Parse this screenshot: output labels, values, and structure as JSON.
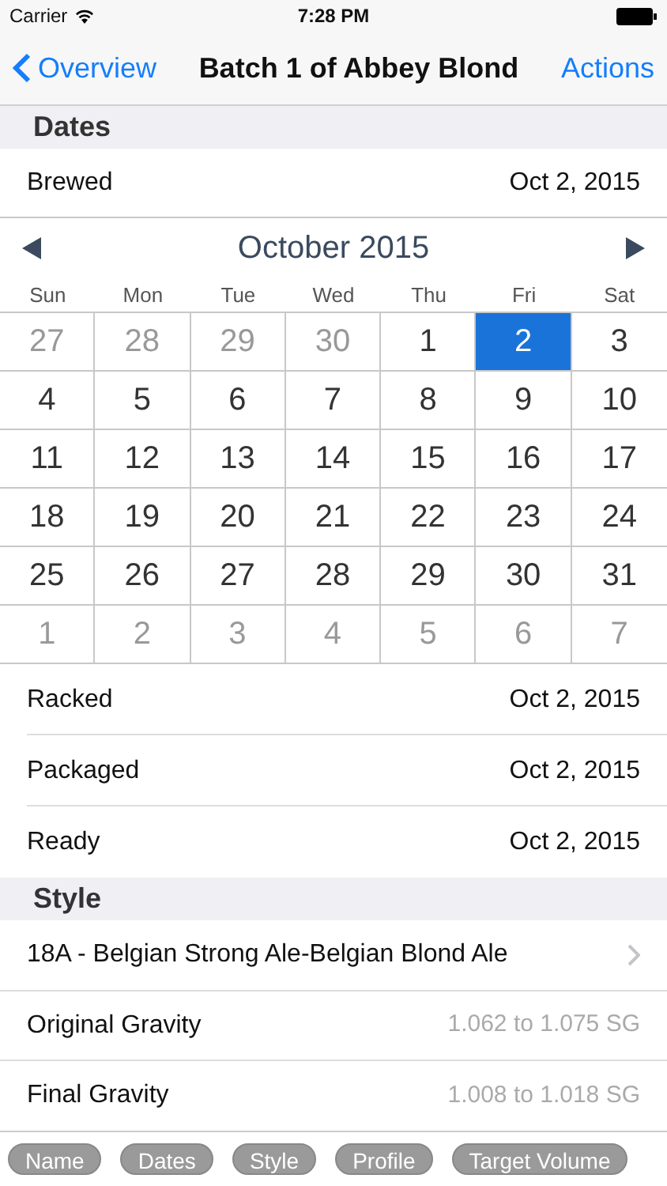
{
  "status_bar": {
    "carrier": "Carrier",
    "time": "7:28 PM"
  },
  "nav": {
    "back": "Overview",
    "title": "Batch 1 of Abbey Blond",
    "action": "Actions"
  },
  "dates_section": {
    "header": "Dates",
    "brewed": {
      "label": "Brewed",
      "value": "Oct 2, 2015"
    },
    "calendar": {
      "month": "October 2015",
      "weekdays": [
        "Sun",
        "Mon",
        "Tue",
        "Wed",
        "Thu",
        "Fri",
        "Sat"
      ],
      "days": [
        {
          "text": "27",
          "outside": true,
          "selected": false
        },
        {
          "text": "28",
          "outside": true,
          "selected": false
        },
        {
          "text": "29",
          "outside": true,
          "selected": false
        },
        {
          "text": "30",
          "outside": true,
          "selected": false
        },
        {
          "text": "1",
          "outside": false,
          "selected": false
        },
        {
          "text": "2",
          "outside": false,
          "selected": true
        },
        {
          "text": "3",
          "outside": false,
          "selected": false
        },
        {
          "text": "4",
          "outside": false,
          "selected": false
        },
        {
          "text": "5",
          "outside": false,
          "selected": false
        },
        {
          "text": "6",
          "outside": false,
          "selected": false
        },
        {
          "text": "7",
          "outside": false,
          "selected": false
        },
        {
          "text": "8",
          "outside": false,
          "selected": false
        },
        {
          "text": "9",
          "outside": false,
          "selected": false
        },
        {
          "text": "10",
          "outside": false,
          "selected": false
        },
        {
          "text": "11",
          "outside": false,
          "selected": false
        },
        {
          "text": "12",
          "outside": false,
          "selected": false
        },
        {
          "text": "13",
          "outside": false,
          "selected": false
        },
        {
          "text": "14",
          "outside": false,
          "selected": false
        },
        {
          "text": "15",
          "outside": false,
          "selected": false
        },
        {
          "text": "16",
          "outside": false,
          "selected": false
        },
        {
          "text": "17",
          "outside": false,
          "selected": false
        },
        {
          "text": "18",
          "outside": false,
          "selected": false
        },
        {
          "text": "19",
          "outside": false,
          "selected": false
        },
        {
          "text": "20",
          "outside": false,
          "selected": false
        },
        {
          "text": "21",
          "outside": false,
          "selected": false
        },
        {
          "text": "22",
          "outside": false,
          "selected": false
        },
        {
          "text": "23",
          "outside": false,
          "selected": false
        },
        {
          "text": "24",
          "outside": false,
          "selected": false
        },
        {
          "text": "25",
          "outside": false,
          "selected": false
        },
        {
          "text": "26",
          "outside": false,
          "selected": false
        },
        {
          "text": "27",
          "outside": false,
          "selected": false
        },
        {
          "text": "28",
          "outside": false,
          "selected": false
        },
        {
          "text": "29",
          "outside": false,
          "selected": false
        },
        {
          "text": "30",
          "outside": false,
          "selected": false
        },
        {
          "text": "31",
          "outside": false,
          "selected": false
        },
        {
          "text": "1",
          "outside": true,
          "selected": false
        },
        {
          "text": "2",
          "outside": true,
          "selected": false
        },
        {
          "text": "3",
          "outside": true,
          "selected": false
        },
        {
          "text": "4",
          "outside": true,
          "selected": false
        },
        {
          "text": "5",
          "outside": true,
          "selected": false
        },
        {
          "text": "6",
          "outside": true,
          "selected": false
        },
        {
          "text": "7",
          "outside": true,
          "selected": false
        }
      ]
    },
    "rows": [
      {
        "label": "Racked",
        "value": "Oct 2, 2015"
      },
      {
        "label": "Packaged",
        "value": "Oct 2, 2015"
      },
      {
        "label": "Ready",
        "value": "Oct 2, 2015"
      }
    ]
  },
  "style_section": {
    "header": "Style",
    "style": "18A - Belgian Strong Ale-Belgian Blond Ale",
    "rows": [
      {
        "label": "Original Gravity",
        "value": "1.062 to 1.075 SG"
      },
      {
        "label": "Final Gravity",
        "value": "1.008 to 1.018 SG"
      }
    ]
  },
  "section_tabs": [
    "Name",
    "Dates",
    "Style",
    "Profile",
    "Target Volume"
  ]
}
